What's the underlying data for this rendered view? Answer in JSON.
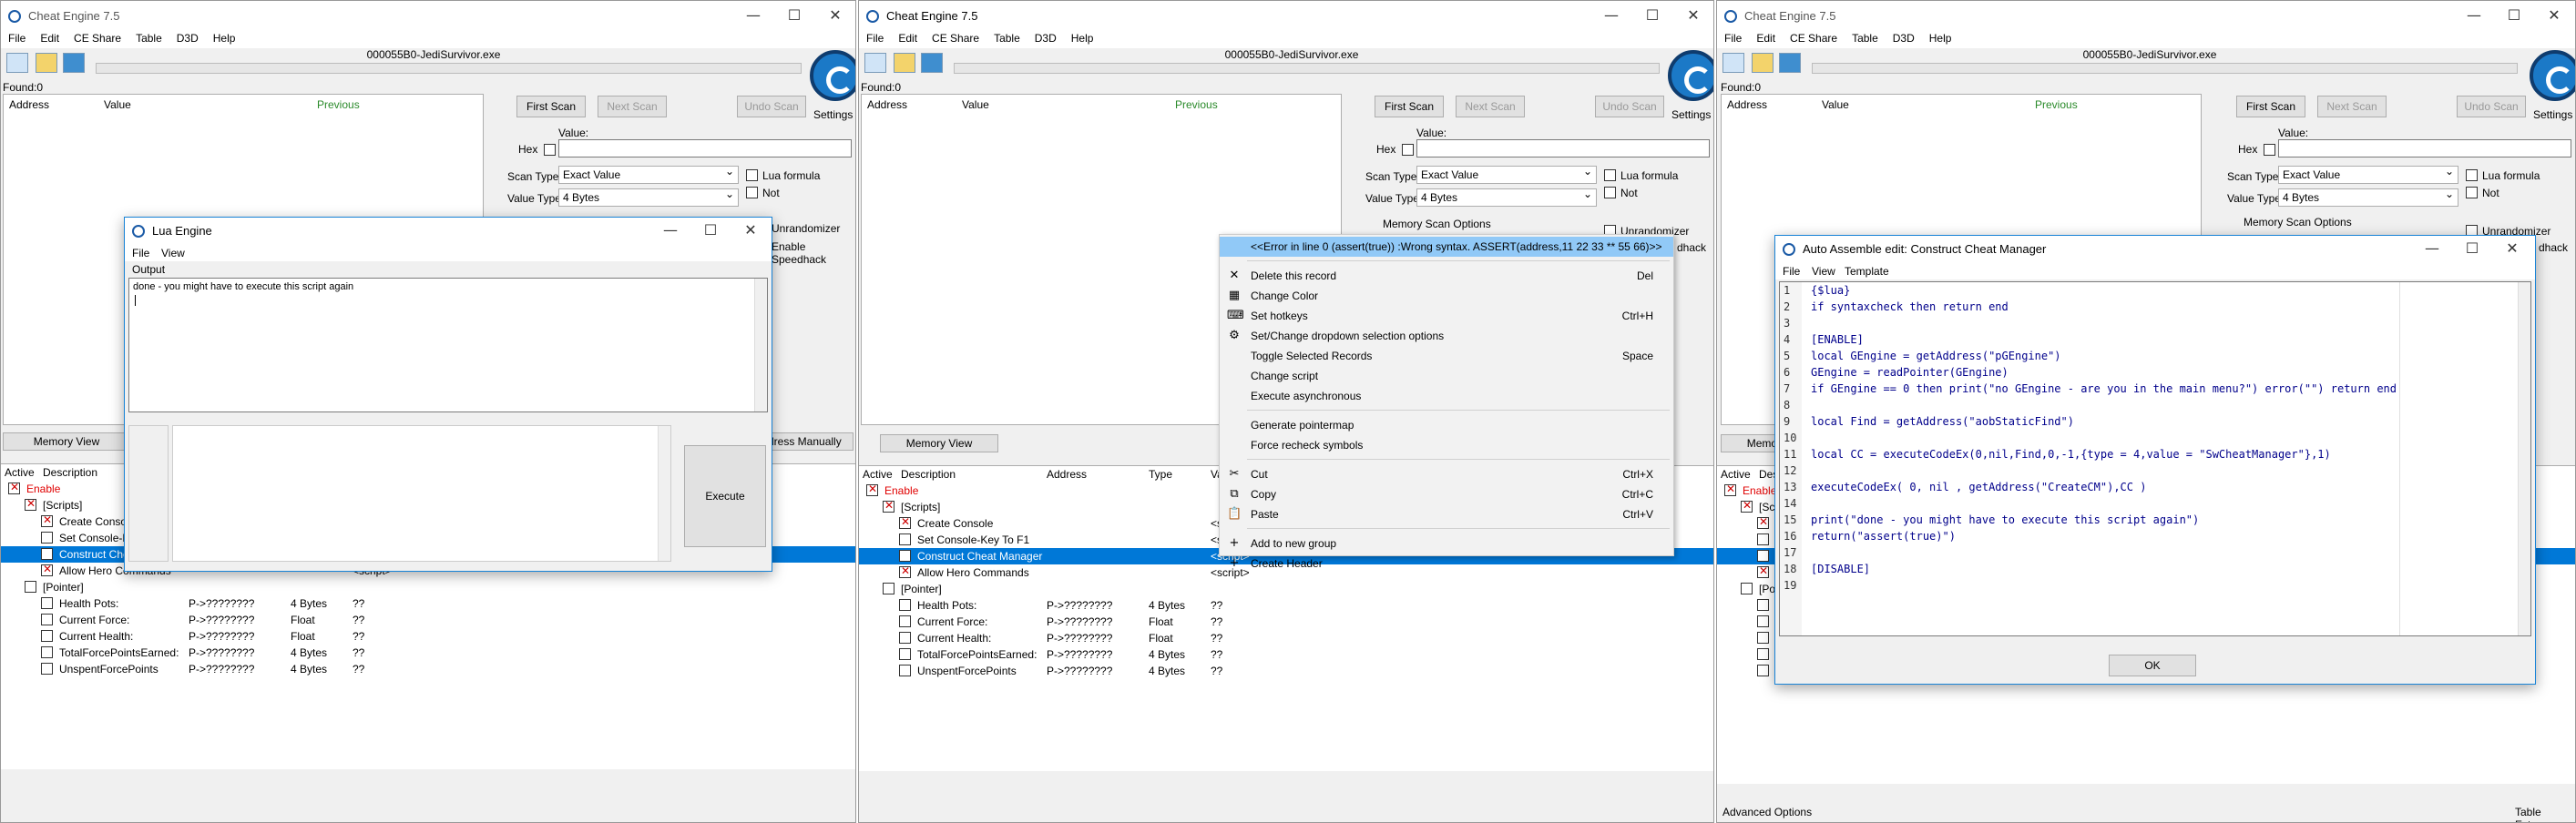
{
  "windows": [
    {
      "title": "Cheat Engine 7.5",
      "menu": [
        "File",
        "Edit",
        "CE Share",
        "Table",
        "D3D",
        "Help"
      ],
      "process": "000055B0-JediSurvivor.exe",
      "found": "Found:0",
      "cols": [
        "Address",
        "Value",
        "Previous"
      ],
      "first_scan": "First Scan",
      "next_scan": "Next Scan",
      "undo_scan": "Undo Scan",
      "settings": "Settings",
      "value_label": "Value:",
      "hex": "Hex",
      "scan_type_label": "Scan Type",
      "scan_type": "Exact Value",
      "value_type_label": "Value Type",
      "value_type": "4 Bytes",
      "lua_formula": "Lua formula",
      "not": "Not",
      "memory_view": "Memory View",
      "add_manually": "Add Address Manually",
      "unrandomizer": "Unrandomizer",
      "speedhack": "Enable Speedhack",
      "tcols": [
        "Active",
        "Description",
        "Address",
        "Type",
        "Value"
      ]
    },
    {
      "title": "Cheat Engine 7.5",
      "memory_scan_options": "Memory Scan Options",
      "speedhack_fragment": "dhack"
    },
    {
      "title": "Cheat Engine 7.5",
      "footer_left": "Advanced Options",
      "footer_right": "Table Extras"
    }
  ],
  "table_rows": [
    {
      "desc": "Enable",
      "addr": "",
      "type": "",
      "value": "",
      "checked": true,
      "indent": 0,
      "style": "red"
    },
    {
      "desc": "[Scripts]",
      "addr": "",
      "type": "",
      "value": "",
      "checked": true,
      "indent": 1
    },
    {
      "desc": "Create Console",
      "addr": "",
      "type": "",
      "value": "<script>",
      "checked": true,
      "indent": 2
    },
    {
      "desc": "Set Console-Key To F1",
      "addr": "",
      "type": "",
      "value": "<script>",
      "checked": false,
      "indent": 2
    },
    {
      "desc": "Construct Cheat Manager",
      "addr": "",
      "type": "",
      "value": "<script>",
      "checked": false,
      "indent": 2,
      "style": "sel"
    },
    {
      "desc": "Allow Hero Commands",
      "addr": "",
      "type": "",
      "value": "<script>",
      "checked": true,
      "indent": 2
    },
    {
      "desc": "[Pointer]",
      "addr": "",
      "type": "",
      "value": "",
      "checked": false,
      "indent": 1
    },
    {
      "desc": "Health Pots:",
      "addr": "P->????????",
      "type": "4 Bytes",
      "value": "??",
      "checked": false,
      "indent": 2
    },
    {
      "desc": "Current Force:",
      "addr": "P->????????",
      "type": "Float",
      "value": "??",
      "checked": false,
      "indent": 2
    },
    {
      "desc": "Current Health:",
      "addr": "P->????????",
      "type": "Float",
      "value": "??",
      "checked": false,
      "indent": 2
    },
    {
      "desc": "TotalForcePointsEarned:",
      "addr": "P->????????",
      "type": "4 Bytes",
      "value": "??",
      "checked": false,
      "indent": 2
    },
    {
      "desc": "UnspentForcePoints",
      "addr": "P->????????",
      "type": "4 Bytes",
      "value": "??",
      "checked": false,
      "indent": 2
    }
  ],
  "lua": {
    "title": "Lua Engine",
    "menu": [
      "File",
      "View"
    ],
    "output_label": "Output",
    "output_text": "done - you might have to execute this script again",
    "execute": "Execute"
  },
  "context_menu": {
    "items": [
      {
        "label": "<<Error in line 0 (assert(true)) :Wrong syntax. ASSERT(address,11 22 33 ** 55 66)>>",
        "key": "",
        "icon": ""
      },
      {
        "label": "Delete this record",
        "key": "Del",
        "icon": "✕"
      },
      {
        "label": "Change Color",
        "key": "",
        "icon": "▦"
      },
      {
        "label": "Set hotkeys",
        "key": "Ctrl+H",
        "icon": "⌨"
      },
      {
        "label": "Set/Change dropdown selection options",
        "key": "",
        "icon": "⚙"
      },
      {
        "label": "Toggle Selected Records",
        "key": "Space",
        "icon": ""
      },
      {
        "label": "Change script",
        "key": "",
        "icon": ""
      },
      {
        "label": "Execute asynchronous",
        "key": "",
        "icon": ""
      },
      {
        "label": "Generate pointermap",
        "key": "",
        "icon": ""
      },
      {
        "label": "Force recheck symbols",
        "key": "",
        "icon": ""
      },
      {
        "label": "Cut",
        "key": "Ctrl+X",
        "icon": "✂"
      },
      {
        "label": "Copy",
        "key": "Ctrl+C",
        "icon": "⧉"
      },
      {
        "label": "Paste",
        "key": "Ctrl+V",
        "icon": "📋"
      },
      {
        "label": "Add to new group",
        "key": "",
        "icon": "+"
      },
      {
        "label": "Create Header",
        "key": "",
        "icon": "+"
      }
    ]
  },
  "auto_assemble": {
    "title": "Auto Assemble edit: Construct Cheat Manager",
    "menu": [
      "File",
      "View",
      "Template"
    ],
    "ok": "OK",
    "line_numbers": [
      "1",
      "2",
      "3",
      "4",
      "5",
      "6",
      "7",
      "8",
      "9",
      "10",
      "11",
      "12",
      "13",
      "14",
      "15",
      "16",
      "17",
      "18",
      "19"
    ],
    "lines": [
      "{$lua}",
      "if syntaxcheck then return end",
      "",
      "[ENABLE]",
      "local GEngine = getAddress(\"pGEngine\")",
      "GEngine = readPointer(GEngine)",
      "if GEngine == 0 then print(\"no GEngine - are you in the main menu?\") error(\"\") return end",
      "",
      "local Find = getAddress(\"aobStaticFind\")",
      "",
      "local CC = executeCodeEx(0,nil,Find,0,-1,{type = 4,value = \"SwCheatManager\"},1)",
      "",
      "executeCodeEx( 0, nil , getAddress(\"CreateCM\"),CC )",
      "",
      "print(\"done - you might have to execute this script again\")",
      "return(\"assert(true)\")",
      "",
      "[DISABLE]",
      ""
    ]
  }
}
